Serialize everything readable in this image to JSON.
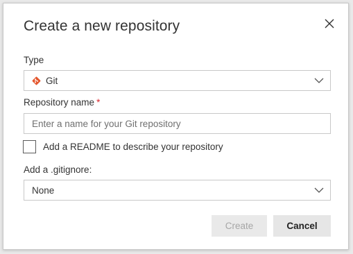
{
  "dialog": {
    "title": "Create a new repository",
    "close_icon": "close-icon"
  },
  "type_field": {
    "label": "Type",
    "selected_value": "Git",
    "icon": "git-logo-icon",
    "icon_color": "#e4572e"
  },
  "name_field": {
    "label": "Repository name",
    "required_marker": "*",
    "placeholder": "Enter a name for your Git repository",
    "value": ""
  },
  "readme_option": {
    "label": "Add a README to describe your repository",
    "checked": false
  },
  "gitignore_field": {
    "label": "Add a .gitignore:",
    "selected_value": "None"
  },
  "buttons": {
    "create_label": "Create",
    "create_enabled": false,
    "cancel_label": "Cancel"
  },
  "colors": {
    "required": "#d9272e",
    "border": "#c8c8c8",
    "disabled_text": "#a6a6a6"
  }
}
